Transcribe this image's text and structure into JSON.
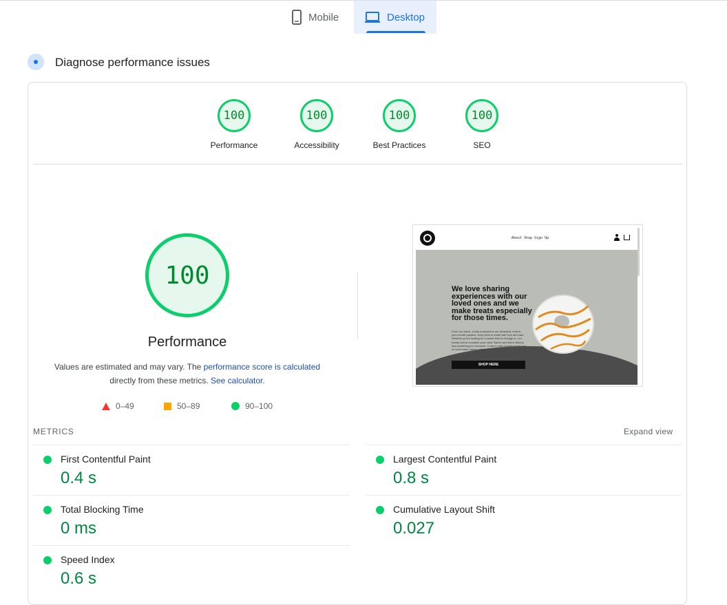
{
  "tabs": [
    {
      "label": "Mobile",
      "icon": "smartphone-icon",
      "selected": false
    },
    {
      "label": "Desktop",
      "icon": "laptop-icon",
      "selected": true
    }
  ],
  "diagnose": {
    "title": "Diagnose performance issues"
  },
  "categories": [
    {
      "score": "100",
      "label": "Performance"
    },
    {
      "score": "100",
      "label": "Accessibility"
    },
    {
      "score": "100",
      "label": "Best Practices"
    },
    {
      "score": "100",
      "label": "SEO"
    }
  ],
  "performance": {
    "score": "100",
    "title": "Performance",
    "desc_1": "Values are estimated and may vary. The ",
    "desc_link_1": "performance score is calculated",
    "desc_2": "directly from these metrics. ",
    "desc_link_2": "See calculator",
    "desc_3": "."
  },
  "legend": [
    {
      "range": "0–49",
      "shape": "triangle",
      "color": "#ff3333"
    },
    {
      "range": "50–89",
      "shape": "square",
      "color": "#ffa400"
    },
    {
      "range": "90–100",
      "shape": "circle",
      "color": "#0cce6b"
    }
  ],
  "thumbnail": {
    "nav": "About  Shop  Sign Up",
    "headline": "We love sharing experiences with our loved ones and we make treats especially for those times.",
    "body": "From our warm, crusty croissant to our decadent, melt-in-your-mouth pastries, every item is made with love and care. Whether you're looking for a sweet treat to indulge in, or a hearty loaf to complete your meal, Barb's and Bob's Bakery has something for everyone. Come in and experience the joy of homemade baking today.",
    "button": "SHOP HERE"
  },
  "metrics": {
    "header": "METRICS",
    "expand": "Expand view",
    "items": [
      {
        "name": "First Contentful Paint",
        "value": "0.4 s"
      },
      {
        "name": "Largest Contentful Paint",
        "value": "0.8 s"
      },
      {
        "name": "Total Blocking Time",
        "value": "0 ms"
      },
      {
        "name": "Cumulative Layout Shift",
        "value": "0.027"
      },
      {
        "name": "Speed Index",
        "value": "0.6 s"
      }
    ]
  },
  "colors": {
    "accent": "#1a73e8",
    "pass": "#0cce6b",
    "pass_text": "#018642"
  }
}
